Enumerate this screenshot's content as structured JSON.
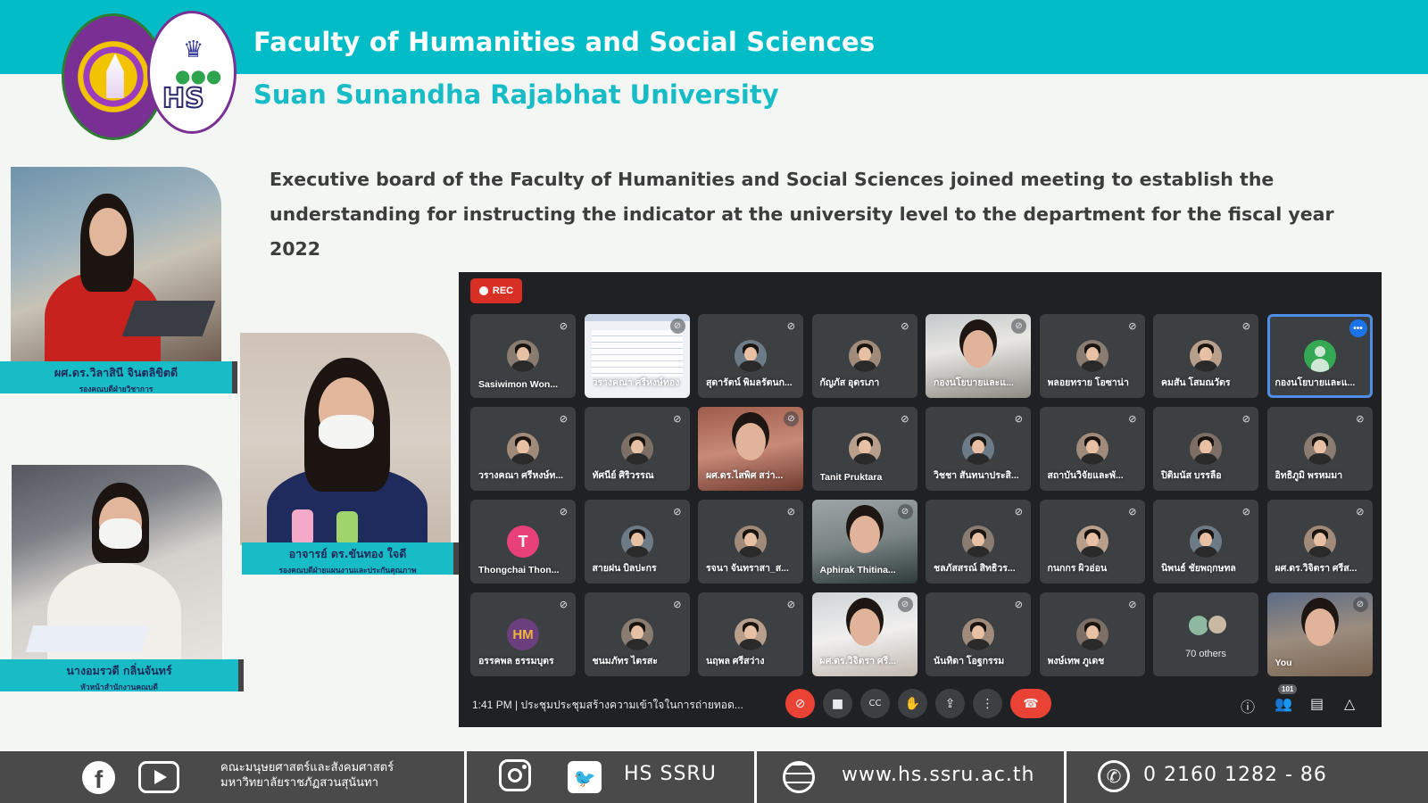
{
  "header": {
    "title": "Faculty of Humanities and Social Sciences",
    "subtitle": "Suan Sunandha Rajabhat University",
    "logo_left": "ssru-university-seal",
    "logo_right": "hs-faculty-seal",
    "logo_right_text": "HS",
    "band_color": "#00bcc6"
  },
  "headline": "Executive board of the Faculty of Humanities and Social Sciences joined meeting to establish the understanding for instructing the indicator at the university level to the department for the fiscal year 2022",
  "people": [
    {
      "name": "ผศ.ดร.วิลาสินี จินตลิขิตดี",
      "role": "รองคณบดีฝ่ายวิชาการ"
    },
    {
      "name": "อาจารย์ ดร.ขันทอง ใจดี",
      "role": "รองคณบดีฝ่ายแผนงานและประกันคุณภาพ"
    },
    {
      "name": "นางอมรวดี กลิ่นจันทร์",
      "role": "หัวหน้าสำนักงานคณบดี"
    }
  ],
  "meeting": {
    "rec_label": "REC",
    "participants": [
      {
        "name": "Sasiwimon Won...",
        "kind": "avatar"
      },
      {
        "name": "วรางคณา ศรีหงษ์ทอง",
        "kind": "screen"
      },
      {
        "name": "สุดารัตน์ พิมลรัตนก...",
        "kind": "avatar"
      },
      {
        "name": "กัญภัส อุดรเภา",
        "kind": "avatar"
      },
      {
        "name": "กองนโยบายและแ...",
        "kind": "video"
      },
      {
        "name": "พลอยทราย โอซาน่า",
        "kind": "avatar"
      },
      {
        "name": "คมสัน โสมณวัตร",
        "kind": "avatar"
      },
      {
        "name": "กองนโยบายและแ...",
        "kind": "active"
      },
      {
        "name": "วรางคณา ศรีหงษ์ท...",
        "kind": "avatar"
      },
      {
        "name": "ทัศนีย์ ศิริวรรณ",
        "kind": "avatar"
      },
      {
        "name": "ผศ.ดร.ไสพิศ สว่า...",
        "kind": "video"
      },
      {
        "name": "Tanit Pruktara",
        "kind": "avatar"
      },
      {
        "name": "วิชชา สันทนาประสิ...",
        "kind": "avatar"
      },
      {
        "name": "สถาบันวิจัยและพั...",
        "kind": "avatar"
      },
      {
        "name": "ปิติมนัส บรรลือ",
        "kind": "avatar"
      },
      {
        "name": "อิทธิภูมิ พรหมมา",
        "kind": "avatar"
      },
      {
        "name": "Thongchai Thon...",
        "kind": "letter",
        "letter": "T"
      },
      {
        "name": "สายฝน บิลปะกร",
        "kind": "avatar"
      },
      {
        "name": "รจนา จันทราสา_ส...",
        "kind": "avatar"
      },
      {
        "name": "Aphirak Thitina...",
        "kind": "video"
      },
      {
        "name": "ชลภัสสรณ์ สิทธิวร...",
        "kind": "avatar"
      },
      {
        "name": "กนกกร ผิวอ่อน",
        "kind": "avatar"
      },
      {
        "name": "นิพนธ์ ชัยพฤกษทล",
        "kind": "avatar"
      },
      {
        "name": "ผศ.ดร.วิจิตรา ศรีส...",
        "kind": "avatar"
      },
      {
        "name": "อรรคพล ธรรมบุตร",
        "kind": "hm",
        "letter": "HM"
      },
      {
        "name": "ชนมภัทร ไตรสะ",
        "kind": "avatar"
      },
      {
        "name": "นฤพล ศรีสว่าง",
        "kind": "avatar"
      },
      {
        "name": "ผศ.ดร.วิจิตรา ศรี...",
        "kind": "video"
      },
      {
        "name": "นันทิดา โอฐกรรม",
        "kind": "avatar"
      },
      {
        "name": "พงษ์เทพ ภูเดช",
        "kind": "avatar"
      },
      {
        "name": "70 others",
        "kind": "others"
      },
      {
        "name": "You",
        "kind": "video"
      }
    ],
    "time": "1:41 PM",
    "meeting_title": "ประชุมประชุมสร้างความเข้าใจในการถ่ายทอด...",
    "participant_count": "101",
    "controls": [
      "mic-off-icon",
      "camera-icon",
      "captions-icon",
      "raise-hand-icon",
      "present-icon",
      "more-vert-icon",
      "end-call-icon"
    ],
    "right_controls": [
      "info-icon",
      "people-icon",
      "chat-icon",
      "activities-icon"
    ]
  },
  "footer": {
    "faculty_th_line1": "คณะมนุษยศาสตร์และสังคมศาสตร์",
    "faculty_th_line2": "มหาวิทยาลัยราชภัฏสวนสุนันทา",
    "social": "HS SSRU",
    "website": "www.hs.ssru.ac.th",
    "phone": "0  2160 1282 - 86"
  }
}
